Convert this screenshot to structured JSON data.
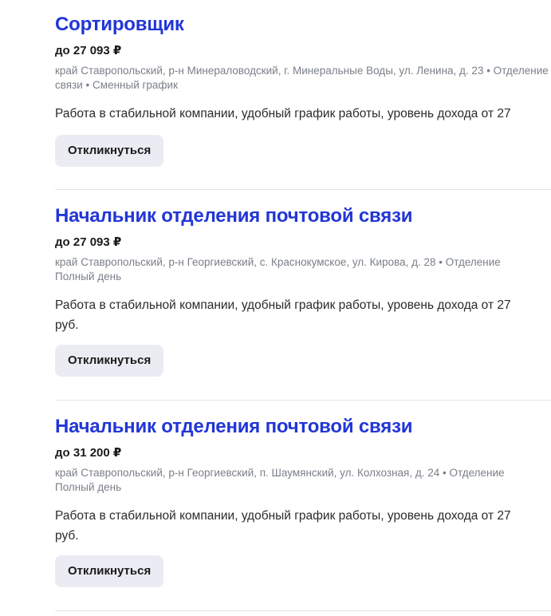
{
  "vacancies": [
    {
      "title": "Сортировщик",
      "salary": "до 27 093 ₽",
      "meta_line1": "край Ставропольский, р-н Минераловодский, г. Минеральные Воды, ул. Ленина, д. 23 • Отделение",
      "meta_line2": "связи • Сменный график",
      "desc_line1": "Работа в стабильной компании, удобный график работы, уровень дохода от 27",
      "desc_line2": "",
      "apply_label": "Откликнуться"
    },
    {
      "title": "Начальник отделения почтовой связи",
      "salary": "до 27 093 ₽",
      "meta_line1": "край Ставропольский, р-н Георгиевский, с. Краснокумское, ул. Кирова, д. 28 • Отделение",
      "meta_line2": "Полный день",
      "desc_line1": "Работа в стабильной компании, удобный график работы, уровень дохода от 27",
      "desc_line2": "руб.",
      "apply_label": "Откликнуться"
    },
    {
      "title": "Начальник отделения почтовой связи",
      "salary": "до 31 200 ₽",
      "meta_line1": "край Ставропольский, р-н Георгиевский, п. Шаумянский, ул. Колхозная, д. 24 • Отделение",
      "meta_line2": "Полный день",
      "desc_line1": "Работа в стабильной компании, удобный график работы, уровень дохода от 27",
      "desc_line2": "руб.",
      "apply_label": "Откликнуться"
    }
  ]
}
